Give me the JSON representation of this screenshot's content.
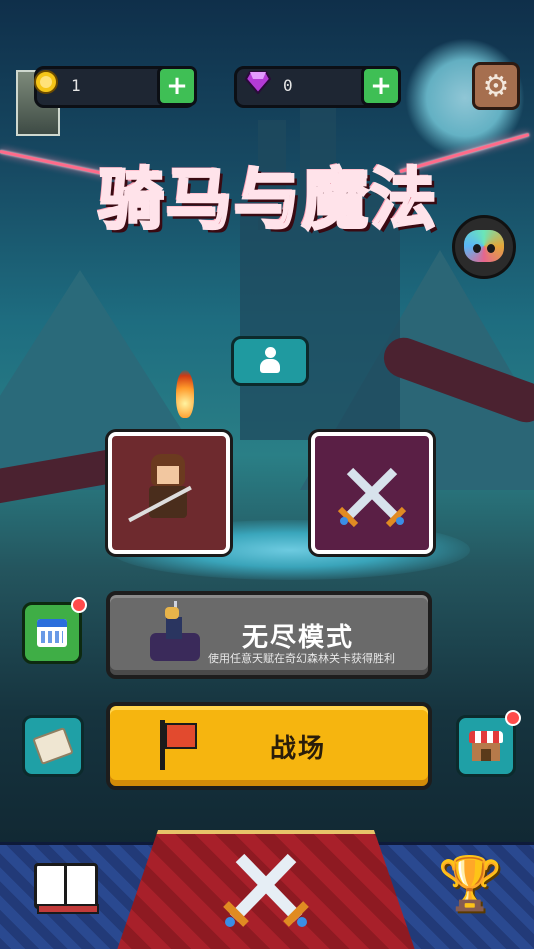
{
  "resources": {
    "gold": {
      "value": "1",
      "icon": "gold-coin-icon"
    },
    "gems": {
      "value": "0",
      "icon": "purple-gem-icon"
    }
  },
  "game_title": "骑马与魔法",
  "endless_mode": {
    "title": "无尽模式",
    "subtitle": "使用任意天赋在奇幻森林关卡获得胜利"
  },
  "battle": {
    "label": "战场"
  },
  "colors": {
    "battle_button": "#f6b50f",
    "endless_button": "#6a6a6a",
    "plus_button": "#3fbf55",
    "title_red": "#b3001f",
    "nav_blue": "#223a78",
    "carpet_red": "#a8202a"
  },
  "icons": {
    "settings": "gear-icon",
    "profile": "user-icon",
    "calendar": "calendar-icon",
    "scroll": "scroll-icon",
    "shop": "shop-icon",
    "book": "book-icon",
    "trophy": "trophy-icon",
    "battle_nav": "crossed-swords-icon",
    "discord": "discord-icon"
  }
}
